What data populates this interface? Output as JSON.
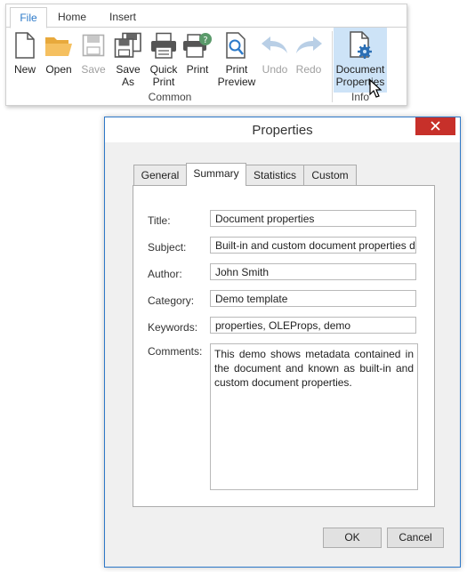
{
  "ribbon": {
    "tabs": [
      {
        "label": "File",
        "active": true
      },
      {
        "label": "Home",
        "active": false
      },
      {
        "label": "Insert",
        "active": false
      }
    ],
    "groups": {
      "common": "Common",
      "info": "Info"
    },
    "buttons": {
      "new": "New",
      "open": "Open",
      "save": "Save",
      "save_as_1": "Save",
      "save_as_2": "As",
      "quick_print_1": "Quick",
      "quick_print_2": "Print",
      "print": "Print",
      "print_preview_1": "Print",
      "print_preview_2": "Preview",
      "undo": "Undo",
      "redo": "Redo",
      "doc_props_1": "Document",
      "doc_props_2": "Properties"
    },
    "colors": {
      "accent": "#2b79c9",
      "selected_bg": "#cde3f7",
      "disabled": "#a0a0a0"
    }
  },
  "dialog": {
    "title": "Properties",
    "close_icon": "close-icon",
    "tabs": [
      {
        "label": "General",
        "active": false
      },
      {
        "label": "Summary",
        "active": true
      },
      {
        "label": "Statistics",
        "active": false
      },
      {
        "label": "Custom",
        "active": false
      }
    ],
    "fields": {
      "title": {
        "label": "Title:",
        "value": "Document properties"
      },
      "subject": {
        "label": "Subject:",
        "value": "Built-in and custom document properties d"
      },
      "author": {
        "label": "Author:",
        "value": "John Smith"
      },
      "category": {
        "label": "Category:",
        "value": "Demo template"
      },
      "keywords": {
        "label": "Keywords:",
        "value": "properties, OLEProps, demo"
      },
      "comments": {
        "label": "Comments:",
        "value": "This demo shows metadata contained in the document and known as built-in and custom document properties."
      }
    },
    "ok_label": "OK",
    "cancel_label": "Cancel",
    "colors": {
      "border": "#2e78c8",
      "close_bg": "#c7302a"
    }
  }
}
